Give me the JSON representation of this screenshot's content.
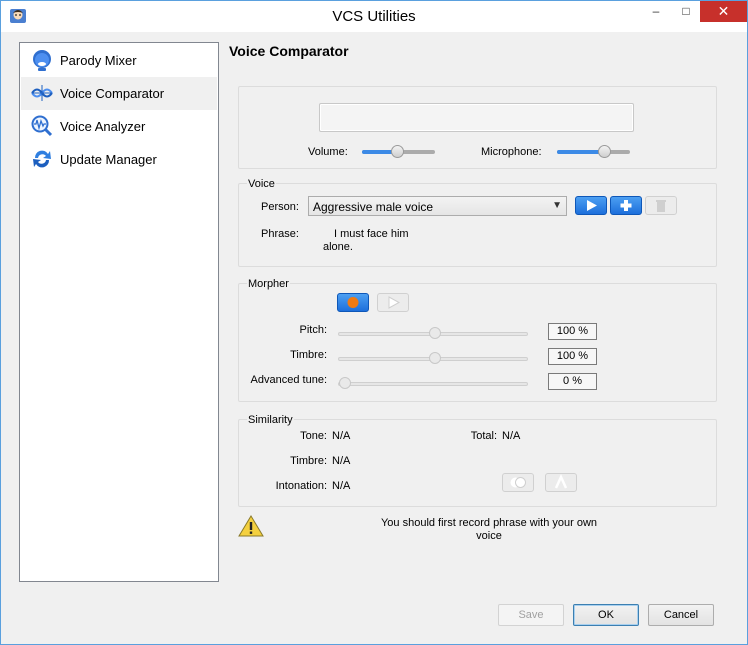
{
  "window": {
    "title": "VCS Utilities",
    "minimize": "–",
    "maximize": "□",
    "close": "✕"
  },
  "sidebar": {
    "items": [
      {
        "label": "Parody Mixer",
        "icon": "parody-mixer-icon"
      },
      {
        "label": "Voice Comparator",
        "icon": "voice-comparator-icon",
        "selected": true
      },
      {
        "label": "Voice Analyzer",
        "icon": "voice-analyzer-icon"
      },
      {
        "label": "Update Manager",
        "icon": "update-manager-icon"
      }
    ]
  },
  "main": {
    "heading": "Voice Comparator",
    "levels": {
      "volume_label": "Volume:",
      "volume_level": 0.48,
      "microphone_label": "Microphone:",
      "microphone_level": 0.65
    },
    "voice": {
      "title": "Voice",
      "person_label": "Person:",
      "person_value": "Aggressive male voice",
      "phrase_label": "Phrase:",
      "phrase_line1": "I must face him",
      "phrase_line2": "alone."
    },
    "morpher": {
      "title": "Morpher",
      "pitch_label": "Pitch:",
      "pitch_value": "100 %",
      "timbre_label": "Timbre:",
      "timbre_value": "100 %",
      "advanced_label": "Advanced tune:",
      "advanced_value": "0 %"
    },
    "similarity": {
      "title": "Similarity",
      "tone_label": "Tone:",
      "tone_value": "N/A",
      "total_label": "Total:",
      "total_value": "N/A",
      "timbre_label": "Timbre:",
      "timbre_value": "N/A",
      "intonation_label": "Intonation:",
      "intonation_value": "N/A"
    },
    "message": {
      "line1": "You should first record phrase with your own",
      "line2": "voice"
    }
  },
  "footer": {
    "save": "Save",
    "ok": "OK",
    "cancel": "Cancel"
  },
  "colors": {
    "accent": "#1d6fdb",
    "close": "#c7302b",
    "record": "#f07a12"
  }
}
